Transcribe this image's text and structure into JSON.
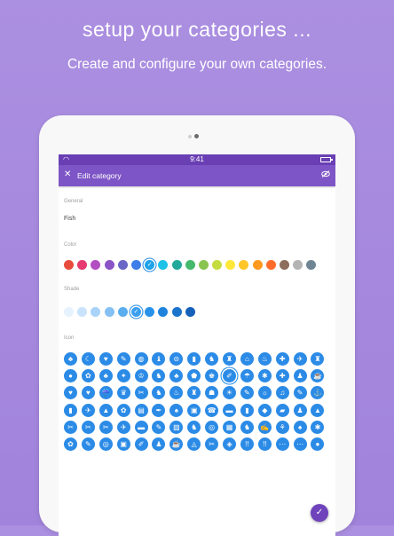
{
  "hero": {
    "headline": "setup your categories ...",
    "subline": "Create and configure your own categories."
  },
  "status_bar": {
    "time": "9:41"
  },
  "app_bar": {
    "close_glyph": "✕",
    "title": "Edit category",
    "action_icon": "eye-off-icon"
  },
  "general": {
    "label": "General",
    "name_value": "Fish"
  },
  "color": {
    "label": "Color",
    "selected_index": 6,
    "swatches": [
      "#e84c3d",
      "#e63b6f",
      "#b34ec2",
      "#8a54c7",
      "#6a66c6",
      "#3d7ee8",
      "#1ea3e8",
      "#1ec2e6",
      "#23a99b",
      "#45b96c",
      "#8ac450",
      "#c4dc3e",
      "#ffe83a",
      "#ffc62a",
      "#ff9a1f",
      "#fe6c2b",
      "#8e6d5c",
      "#b4b4b4",
      "#6f8594"
    ]
  },
  "shade": {
    "label": "Shade",
    "selected_index": 5,
    "swatches": [
      "#e6f2fd",
      "#c9e3fb",
      "#a9d3f8",
      "#84c0f4",
      "#5aaeef",
      "#3b9ff0",
      "#2892ea",
      "#1f83de",
      "#1a73cd",
      "#1560b8"
    ]
  },
  "icon": {
    "label": "Icon",
    "selected_index": 24,
    "glyphs": [
      "♣",
      "☾",
      "♥",
      "✎",
      "◍",
      "♝",
      "⊝",
      "▮",
      "♞",
      "♜",
      "⌂",
      "♨",
      "✚",
      "✈",
      "♜",
      "●",
      "✿",
      "♣",
      "✦",
      "♔",
      "♞",
      "♣",
      "⬟",
      "♚",
      "✐",
      "☂",
      "✱",
      "✚",
      "♟",
      "☕",
      "♥",
      "♥",
      "☔",
      "♛",
      "✂",
      "♞",
      "♨",
      "♜",
      "☗",
      "☀",
      "✎",
      "☼",
      "♫",
      "✎",
      "⚓",
      "▮",
      "✈",
      "▲",
      "✿",
      "▤",
      "✒",
      "♠",
      "▣",
      "☎",
      "▬",
      "▮",
      "◆",
      "▰",
      "♟",
      "▲",
      "✂",
      "✂",
      "✂",
      "✈",
      "▬",
      "✎",
      "▨",
      "♞",
      "◎",
      "▦",
      "♞",
      "✍",
      "⚘",
      "♠",
      "✱",
      "✿",
      "✎",
      "◎",
      "▣",
      "✐",
      "♟",
      "☕",
      "◬",
      "✂",
      "◈",
      "!!",
      "!!",
      "⋯",
      "⋯",
      "●"
    ]
  }
}
